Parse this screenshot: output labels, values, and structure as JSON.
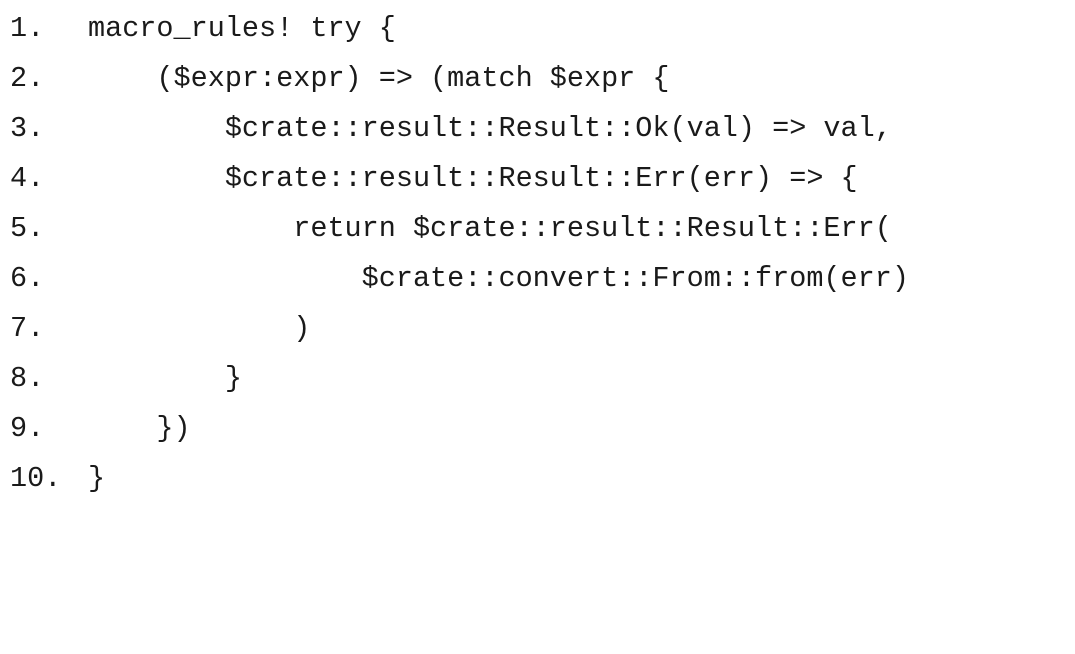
{
  "code": {
    "lines": [
      {
        "number": "1.",
        "text": "macro_rules! try {"
      },
      {
        "number": "2.",
        "text": "    ($expr:expr) => (match $expr {"
      },
      {
        "number": "3.",
        "text": "        $crate::result::Result::Ok(val) => val,"
      },
      {
        "number": "4.",
        "text": "        $crate::result::Result::Err(err) => {"
      },
      {
        "number": "5.",
        "text": "            return $crate::result::Result::Err("
      },
      {
        "number": "6.",
        "text": "                $crate::convert::From::from(err)"
      },
      {
        "number": "7.",
        "text": "            )"
      },
      {
        "number": "8.",
        "text": "        }"
      },
      {
        "number": "9.",
        "text": "    })"
      },
      {
        "number": "10.",
        "text": "}"
      }
    ]
  }
}
